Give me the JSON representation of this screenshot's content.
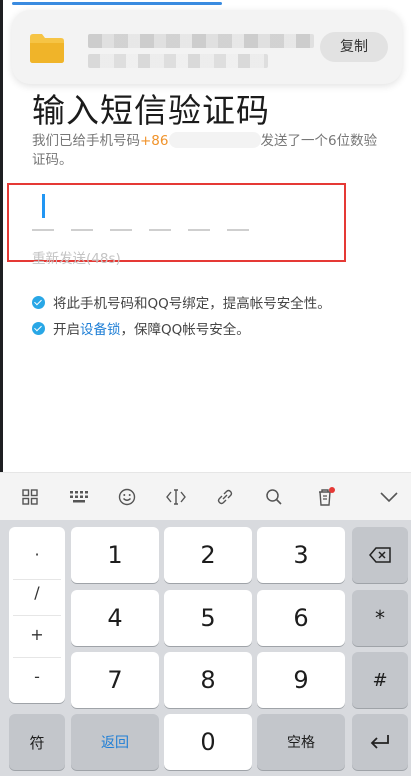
{
  "notification": {
    "copy_label": "复制"
  },
  "page": {
    "title": "输入短信验证码",
    "desc_before": "我们已给手机号码",
    "phone_prefix": "+86",
    "desc_after": "发送了一个6位数验证码。",
    "resend": "重新发送(48s)",
    "option1": "将此手机号码和QQ号绑定，提高帐号安全性。",
    "option2_before": "开启",
    "option2_link": "设备锁",
    "option2_after": "，保障QQ帐号安全。"
  },
  "keyboard": {
    "toolbar_icons": [
      "grid-icon",
      "keyboard-icon",
      "emoji-icon",
      "cursor-move-icon",
      "link-icon",
      "search-icon",
      "clipboard-icon",
      "collapse-icon"
    ],
    "side_symbols": [
      "·",
      "/",
      "+",
      "-"
    ],
    "digits": [
      "1",
      "2",
      "3",
      "4",
      "5",
      "6",
      "7",
      "8",
      "9",
      "0"
    ],
    "star": "*",
    "hash": "#",
    "symbol_label": "符",
    "back_label": "返回",
    "space_label": "空格"
  }
}
